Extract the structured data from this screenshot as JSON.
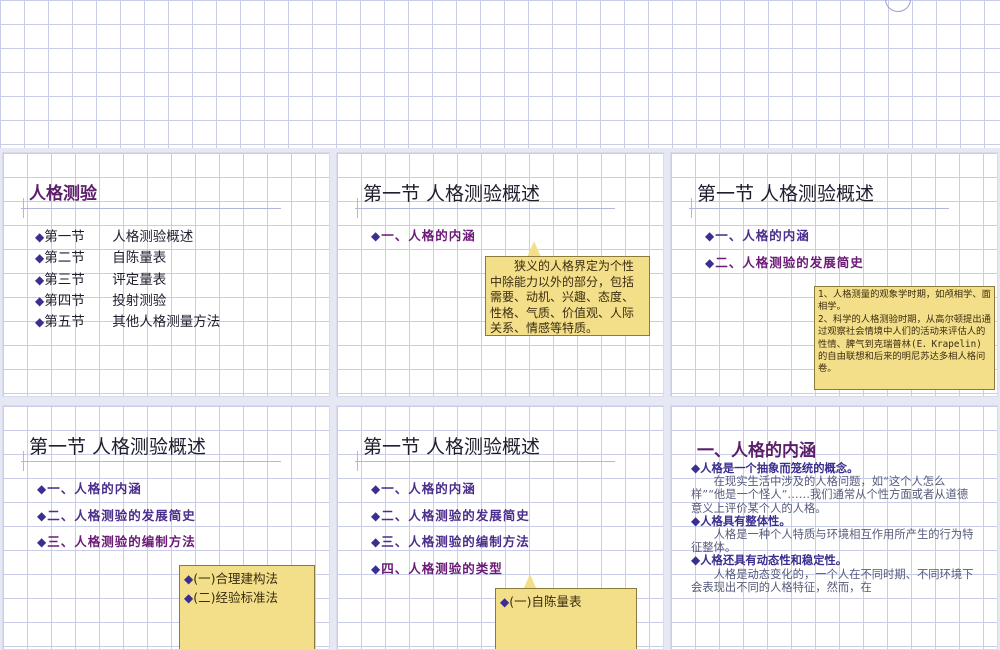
{
  "slide1": {
    "title": "人格测验",
    "items": [
      {
        "num": "第一节",
        "text": "人格测验概述"
      },
      {
        "num": "第二节",
        "text": "自陈量表"
      },
      {
        "num": "第三节",
        "text": "评定量表"
      },
      {
        "num": "第四节",
        "text": "投射测验"
      },
      {
        "num": "第五节",
        "text": "其他人格测量方法"
      }
    ]
  },
  "slide2": {
    "title": "第一节  人格测验概述",
    "heads": [
      "一、人格的内涵"
    ],
    "note": "狭义的人格界定为个性中除能力以外的部分，包括需要、动机、兴趣、态度、性格、气质、价值观、人际关系、情感等特质。"
  },
  "slide3": {
    "title": "第一节  人格测验概述",
    "heads": [
      "一、人格的内涵",
      "二、人格测验的发展简史"
    ],
    "note": "1、人格测量的观象学时期，如颅相学、面相学。\n2、科学的人格测验时期，从高尔顿提出通过观察社会情境中人们的活动来评估人的性情、脾气到克瑞普林(E．Krapelin)的自由联想和后来的明尼苏达多相人格问卷。"
  },
  "slide4": {
    "title": "第一节  人格测验概述",
    "heads": [
      "一、人格的内涵",
      "二、人格测验的发展简史",
      "三、人格测验的编制方法"
    ],
    "subs": [
      "(一)合理建构法",
      "(二)经验标准法"
    ]
  },
  "slide5": {
    "title": "第一节  人格测验概述",
    "heads": [
      "一、人格的内涵",
      "二、人格测验的发展简史",
      "三、人格测验的编制方法",
      "四、人格测验的类型"
    ],
    "subs": [
      "(一)自陈量表"
    ]
  },
  "slide6": {
    "title": "一、人格的内涵",
    "blocks": [
      {
        "bold": "人格是一个抽象而笼统的概念。",
        "text": "在现实生活中涉及的人格问题，如“这个人怎么样”“他是一个怪人”……我们通常从个性方面或者从道德意义上评价某个人的人格。"
      },
      {
        "bold": "人格具有整体性。",
        "text": "人格是一种个人特质与环境相互作用所产生的行为特征整体。"
      },
      {
        "bold": "人格还具有动态性和稳定性。",
        "text": "人格是动态变化的，一个人在不同时期、不同环境下会表现出不同的人格特征，然而，在"
      }
    ]
  },
  "colors": {
    "grid": "#c9cde8",
    "title_purple": "#5b1f6a",
    "head_purple": "#4a2d8c",
    "note_yellow": "#f3df8a"
  },
  "icons": {
    "bullet": "diamond-bullet-icon"
  }
}
